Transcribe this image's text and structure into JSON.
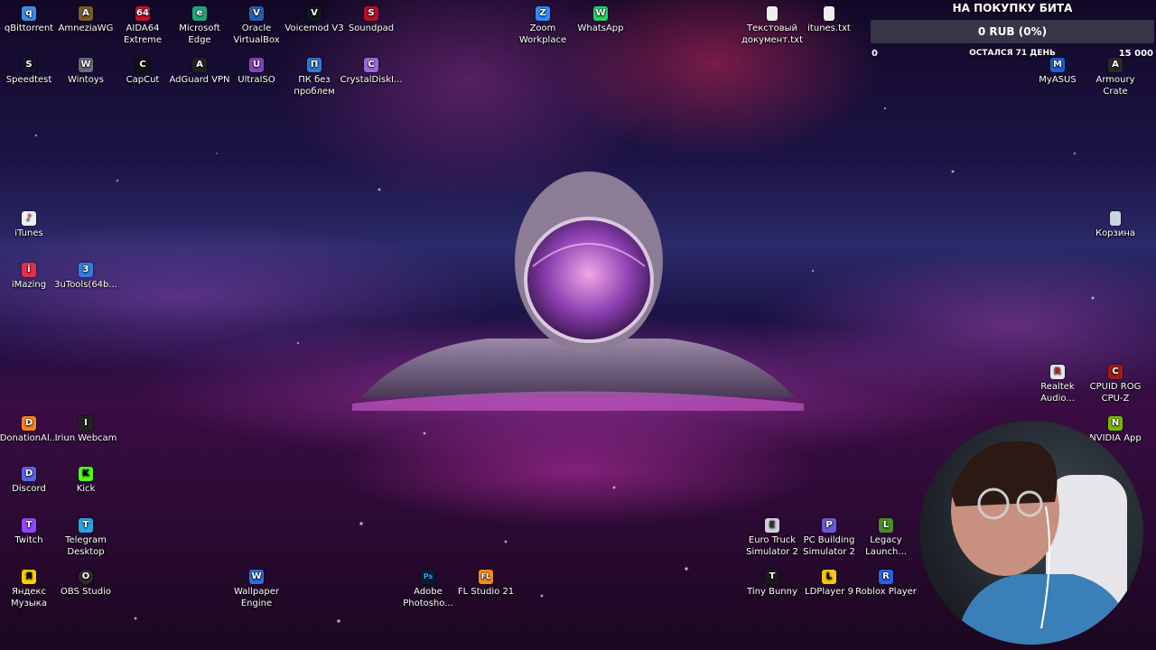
{
  "desktop": {
    "icons": [
      {
        "id": "qbittorrent",
        "label": "qBittorrent",
        "icon": "qbittorrent-icon",
        "color": "#3c8ce7",
        "glyph": "q"
      },
      {
        "id": "amneziawg",
        "label": "AmneziaWG",
        "icon": "amneziawg-icon",
        "color": "#7a5b2c",
        "glyph": "A"
      },
      {
        "id": "aida64",
        "label": "AIDA64 Extreme",
        "icon": "aida64-icon",
        "color": "#c8102e",
        "glyph": "64"
      },
      {
        "id": "edge",
        "label": "Microsoft Edge",
        "icon": "edge-icon",
        "color": "#1ba67a",
        "glyph": "e"
      },
      {
        "id": "virtualbox",
        "label": "Oracle VirtualBox",
        "icon": "virtualbox-icon",
        "color": "#2a5db0",
        "glyph": "V"
      },
      {
        "id": "voicemod",
        "label": "Voicemod V3",
        "icon": "voicemod-icon",
        "color": "#0e1a1a",
        "glyph": "V"
      },
      {
        "id": "soundpad",
        "label": "Soundpad",
        "icon": "soundpad-icon",
        "color": "#b0102a",
        "glyph": "S"
      },
      {
        "id": "zoom",
        "label": "Zoom Workplace",
        "icon": "zoom-icon",
        "color": "#2d8cff",
        "glyph": "Z"
      },
      {
        "id": "whatsapp",
        "label": "WhatsApp",
        "icon": "whatsapp-icon",
        "color": "#25d366",
        "glyph": "W"
      },
      {
        "id": "text-doc",
        "label": "Текстовый документ.txt",
        "icon": "text-file-icon",
        "color": "#eeeeee",
        "glyph": ""
      },
      {
        "id": "itunes-txt",
        "label": "itunes.txt",
        "icon": "text-file-icon",
        "color": "#eeeeee",
        "glyph": ""
      },
      {
        "id": "speedtest",
        "label": "Speedtest",
        "icon": "speedtest-icon",
        "color": "#141526",
        "glyph": "S"
      },
      {
        "id": "wintoys",
        "label": "Wintoys",
        "icon": "wintoys-icon",
        "color": "#6a6a80",
        "glyph": "W"
      },
      {
        "id": "capcut",
        "label": "CapCut",
        "icon": "capcut-icon",
        "color": "#111111",
        "glyph": "C"
      },
      {
        "id": "adguard",
        "label": "AdGuard VPN",
        "icon": "adguard-icon",
        "color": "#222222",
        "glyph": "A"
      },
      {
        "id": "ultraiso",
        "label": "UltraISO",
        "icon": "ultraiso-icon",
        "color": "#8a3fc0",
        "glyph": "U"
      },
      {
        "id": "pk-bez-problem",
        "label": "ПК без проблем",
        "icon": "pk-bez-problem-icon",
        "color": "#2c7ad6",
        "glyph": "П"
      },
      {
        "id": "crystaldisk",
        "label": "CrystalDiskI...",
        "icon": "crystaldisk-icon",
        "color": "#9a6ad8",
        "glyph": "C"
      },
      {
        "id": "myasus",
        "label": "MyASUS",
        "icon": "myasus-icon",
        "color": "#1e5fd6",
        "glyph": "M"
      },
      {
        "id": "armoury",
        "label": "Armoury Crate",
        "icon": "armoury-crate-icon",
        "color": "#2a2a2a",
        "glyph": "A"
      },
      {
        "id": "itunes",
        "label": "iTunes",
        "icon": "itunes-icon",
        "color": "#f0f0f5",
        "glyph": "♪"
      },
      {
        "id": "recycle-bin",
        "label": "Корзина",
        "icon": "recycle-bin-icon",
        "color": "#c9d6e2",
        "glyph": ""
      },
      {
        "id": "imazing",
        "label": "iMazing",
        "icon": "imazing-icon",
        "color": "#e0304a",
        "glyph": "i"
      },
      {
        "id": "3utools",
        "label": "3uTools(64b...",
        "icon": "3utools-icon",
        "color": "#2f7fe0",
        "glyph": "3"
      },
      {
        "id": "realtek",
        "label": "Realtek Audio...",
        "icon": "realtek-icon",
        "color": "#e8e8ee",
        "glyph": "R"
      },
      {
        "id": "cpuid",
        "label": "CPUID ROG CPU-Z",
        "icon": "cpuid-icon",
        "color": "#9e1b1b",
        "glyph": "C"
      },
      {
        "id": "donationalerts",
        "label": "DonationAl...",
        "icon": "donationalerts-icon",
        "color": "#f5841f",
        "glyph": "D"
      },
      {
        "id": "iriun",
        "label": "Iriun Webcam",
        "icon": "iriun-icon",
        "color": "#222222",
        "glyph": "I"
      },
      {
        "id": "nvidia",
        "label": "NVIDIA App",
        "icon": "nvidia-icon",
        "color": "#76b900",
        "glyph": "N"
      },
      {
        "id": "discord",
        "label": "Discord",
        "icon": "discord-icon",
        "color": "#5865f2",
        "glyph": "D"
      },
      {
        "id": "kick",
        "label": "Kick",
        "icon": "kick-icon",
        "color": "#53fc18",
        "glyph": "K"
      },
      {
        "id": "twitch",
        "label": "Twitch",
        "icon": "twitch-icon",
        "color": "#9146ff",
        "glyph": "T"
      },
      {
        "id": "telegram",
        "label": "Telegram Desktop",
        "icon": "telegram-icon",
        "color": "#2aa3e0",
        "glyph": "T"
      },
      {
        "id": "euro-truck",
        "label": "Euro Truck Simulator 2",
        "icon": "euro-truck-icon",
        "color": "#d0d0d8",
        "glyph": "E"
      },
      {
        "id": "pc-building",
        "label": "PC Building Simulator 2",
        "icon": "pc-building-icon",
        "color": "#6b5ad6",
        "glyph": "P"
      },
      {
        "id": "legacy",
        "label": "Legacy Launch...",
        "icon": "legacy-launcher-icon",
        "color": "#4a8a2a",
        "glyph": "L"
      },
      {
        "id": "yandex-music",
        "label": "Яндекс Музыка",
        "icon": "yandex-music-icon",
        "color": "#ffcc00",
        "glyph": "Я"
      },
      {
        "id": "obs",
        "label": "OBS Studio",
        "icon": "obs-icon",
        "color": "#2e2e2e",
        "glyph": "O"
      },
      {
        "id": "wallpaper-engine",
        "label": "Wallpaper Engine",
        "icon": "wallpaper-engine-icon",
        "color": "#2f6fd8",
        "glyph": "W"
      },
      {
        "id": "photoshop",
        "label": "Adobe Photosho...",
        "icon": "photoshop-icon",
        "color": "#001e36",
        "glyph": "Ps"
      },
      {
        "id": "fl-studio",
        "label": "FL Studio 21",
        "icon": "fl-studio-icon",
        "color": "#f58a1f",
        "glyph": "FL"
      },
      {
        "id": "tiny-bunny",
        "label": "Tiny Bunny",
        "icon": "tiny-bunny-icon",
        "color": "#1a1a1a",
        "glyph": "T"
      },
      {
        "id": "ldplayer",
        "label": "LDPlayer 9",
        "icon": "ldplayer-icon",
        "color": "#f5c518",
        "glyph": "L"
      },
      {
        "id": "roblox",
        "label": "Roblox Player",
        "icon": "roblox-icon",
        "color": "#2a63e8",
        "glyph": "R"
      }
    ]
  },
  "donation_widget": {
    "title": "НА ПОКУПКУ БИТА",
    "amount": "0 RUB (0%)",
    "progress": 0,
    "min_label": "0",
    "days_left": "ОСТАЛСЯ 71 ДЕНЬ",
    "max_label": "15 000",
    "bar_color": "#3c3c4b"
  },
  "webcam": {
    "label": "webcam-overlay"
  }
}
